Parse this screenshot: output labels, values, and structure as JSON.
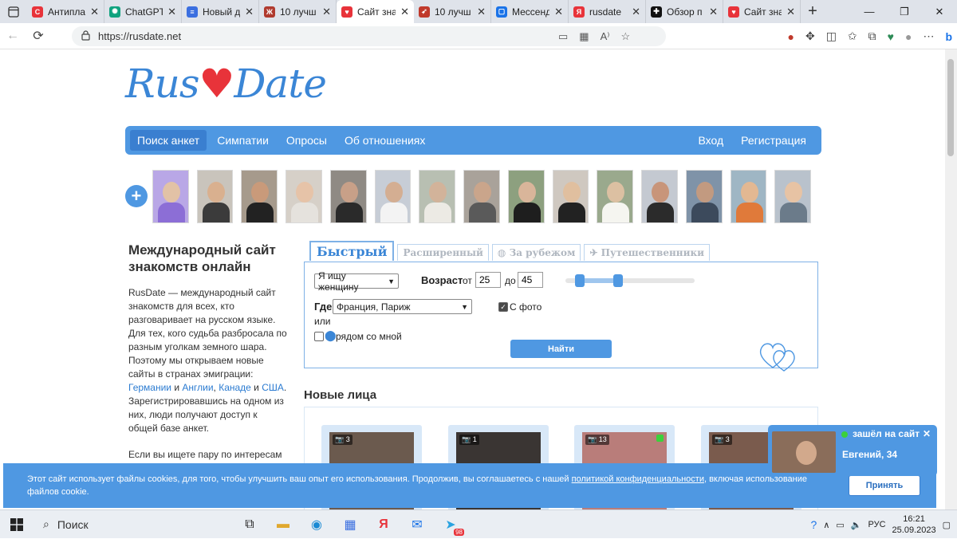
{
  "browser": {
    "tabs": [
      {
        "title": "Антипла",
        "color": "#e8333a",
        "glyph": "C"
      },
      {
        "title": "ChatGPT",
        "color": "#10a37f",
        "glyph": "✺"
      },
      {
        "title": "Новый д",
        "color": "#3b6fe0",
        "glyph": "≡"
      },
      {
        "title": "10 лучш",
        "color": "#b03a2e",
        "glyph": "Ж"
      },
      {
        "title": "Сайт зна",
        "color": "#e8333a",
        "glyph": "♥",
        "active": true
      },
      {
        "title": "10 лучш",
        "color": "#c0392b",
        "glyph": "➶"
      },
      {
        "title": "Мессенд",
        "color": "#1a73e8",
        "glyph": "▢"
      },
      {
        "title": "rusdate",
        "color": "#e8333a",
        "glyph": "Я"
      },
      {
        "title": "Обзор п",
        "color": "#111111",
        "glyph": "✚"
      },
      {
        "title": "Сайт зна",
        "color": "#e8333a",
        "glyph": "♥"
      }
    ],
    "url": "https://rusdate.net"
  },
  "site": {
    "logo_left": "Rus",
    "logo_right": "Date",
    "nav": {
      "left": [
        "Поиск анкет",
        "Симпатии",
        "Опросы",
        "Об отношениях"
      ],
      "right": [
        "Вход",
        "Регистрация"
      ]
    },
    "intro": {
      "title": "Международный сайт знакомств онлайн",
      "p1": "RusDate — международный сайт знакомств для всех, кто разговаривает на русском языке. Для тех, кого судьба разбросала по разным уголкам земного шара. Поэтому мы открываем новые сайты в странах эмиграции: ",
      "link1": "Германии",
      "and1": " и ",
      "link2": "Англии",
      "sep": ", ",
      "link3": "Канаде",
      "and2": " и ",
      "link4": "США",
      "p1_end": ". Зарегистрировавшись на одном из них, люди получают доступ к общей базе анкет.",
      "p2": "Если вы ищете пару по интересам и языку, RusDate идеально"
    },
    "search_tabs": [
      "Быстрый",
      "Расширенный",
      "За рубежом",
      "Путешественники"
    ],
    "search": {
      "looking_for": "Я ищу женщину",
      "age_label": "Возраст",
      "from_label": "от",
      "age_from": "25",
      "to_label": "до",
      "age_to": "45",
      "where_label": "Где",
      "location": "Франция, Париж",
      "with_photo": "С фото",
      "or_label": "или",
      "near_me": "рядом со мной",
      "find_button": "Найти"
    },
    "new_faces_title": "Новые лица",
    "new_faces": [
      {
        "photos": "3",
        "online": false
      },
      {
        "photos": "1",
        "online": false
      },
      {
        "photos": "13",
        "online": true
      },
      {
        "photos": "3",
        "online": false
      }
    ],
    "cookie": {
      "text1": "Этот сайт использует файлы cookies, для того, чтобы улучшить ваш опыт его использования. Продолжив, вы соглашаетесь с нашей ",
      "link": "политикой конфиденциальности",
      "text2": ", включая использование файлов cookie.",
      "accept": "Принять"
    },
    "notification": {
      "status": "зашёл на сайт",
      "name": "Евгений, 34"
    }
  },
  "taskbar": {
    "search": "Поиск",
    "telegram_badge": "98",
    "lang": "РУС",
    "time": "16:21",
    "date": "25.09.2023"
  },
  "colors": {
    "brand_blue": "#4f98e2",
    "heart_red": "#e8333a"
  }
}
